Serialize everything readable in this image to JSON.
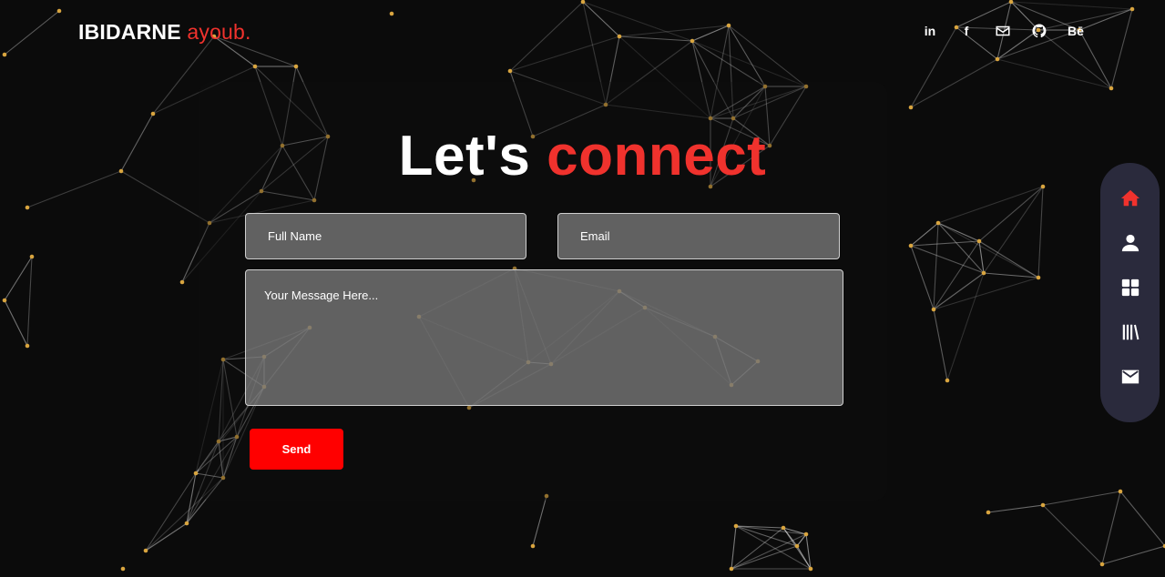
{
  "logo": {
    "first": "IBIDARNE",
    "last": "ayoub."
  },
  "socials": [
    {
      "icon": "linkedin-icon",
      "text": "in"
    },
    {
      "icon": "facebook-icon",
      "text": "f"
    },
    {
      "icon": "mail-icon"
    },
    {
      "icon": "github-icon"
    },
    {
      "icon": "behance-icon",
      "text": "Bē"
    }
  ],
  "heading": {
    "word1": "Let's",
    "word2": "connect"
  },
  "form": {
    "name_placeholder": "Full Name",
    "email_placeholder": "Email",
    "message_placeholder": "Your Message Here...",
    "send_label": "Send"
  },
  "nav": [
    {
      "icon": "home-icon",
      "active": true
    },
    {
      "icon": "user-icon",
      "active": false
    },
    {
      "icon": "grid-icon",
      "active": false
    },
    {
      "icon": "library-icon",
      "active": false
    },
    {
      "icon": "mail-icon",
      "active": false
    }
  ],
  "colors": {
    "accent": "#f0322d",
    "button": "#ff0000",
    "background": "#0b0b0b",
    "sidenav": "#2a2a3c",
    "node": "#d9a53f"
  }
}
